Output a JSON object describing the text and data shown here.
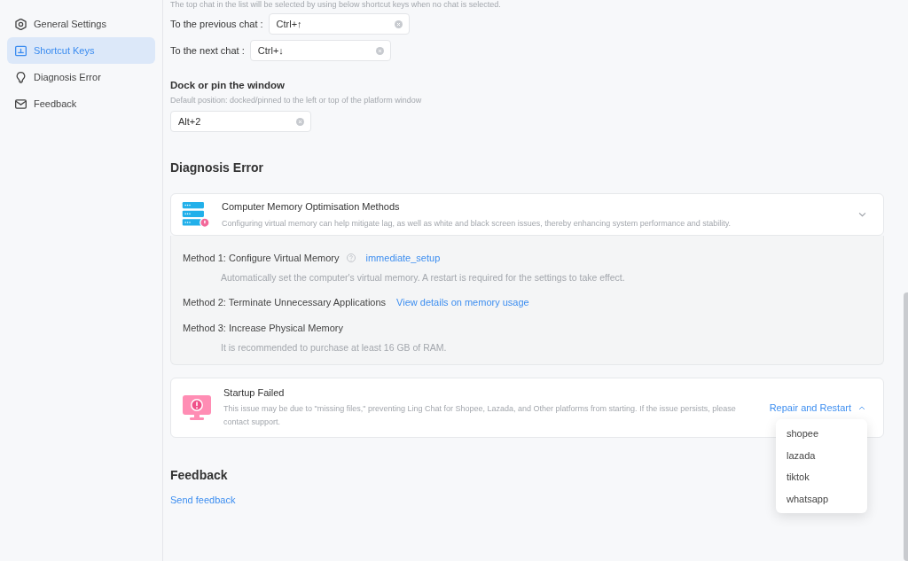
{
  "sidebar": {
    "items": [
      {
        "label": "General Settings",
        "selected": false
      },
      {
        "label": "Shortcut Keys",
        "selected": true
      },
      {
        "label": "Diagnosis Error",
        "selected": false
      },
      {
        "label": "Feedback",
        "selected": false
      }
    ]
  },
  "shortcut_keys": {
    "note": "The top chat in the list will be selected by using below shortcut keys when no chat is selected.",
    "fields": [
      {
        "label": "To the previous chat :",
        "value": "Ctrl+↑"
      },
      {
        "label": "To the next chat :",
        "value": "Ctrl+↓"
      }
    ]
  },
  "dock": {
    "title": "Dock or pin the window",
    "description": "Default position: docked/pinned to the left or top of the platform window",
    "value": "Alt+2"
  },
  "diagnosis": {
    "title": "Diagnosis Error",
    "cards": [
      {
        "kind": "expandable",
        "title": "Computer Memory Optimisation Methods",
        "description": "Configuring virtual memory can help mitigate lag, as well as white and black screen issues, thereby enhancing system performance and stability.",
        "expanded": true,
        "methods": [
          {
            "title": "Method 1: Configure Virtual Memory",
            "help": true,
            "link": "immediate_setup",
            "description": "Automatically set the computer's virtual memory. A restart is required for the settings to take effect."
          },
          {
            "title": "Method 2: Terminate Unnecessary Applications",
            "help": false,
            "link": "View details on memory usage"
          },
          {
            "title": "Method 3: Increase Physical Memory",
            "help": false,
            "description": "It is recommended to purchase at least 16 GB of RAM."
          }
        ]
      },
      {
        "kind": "action",
        "title": "Startup Failed",
        "description": "This issue may be due to \"missing files,\" preventing Ling Chat for Shopee, Lazada, and Other platforms from starting. If the issue persists, please contact support.",
        "action": "Repair and Restart",
        "menu_open": true,
        "menu": [
          "shopee",
          "lazada",
          "tiktok",
          "whatsapp"
        ]
      }
    ]
  },
  "feedback": {
    "title": "Feedback",
    "link": "Send feedback"
  }
}
